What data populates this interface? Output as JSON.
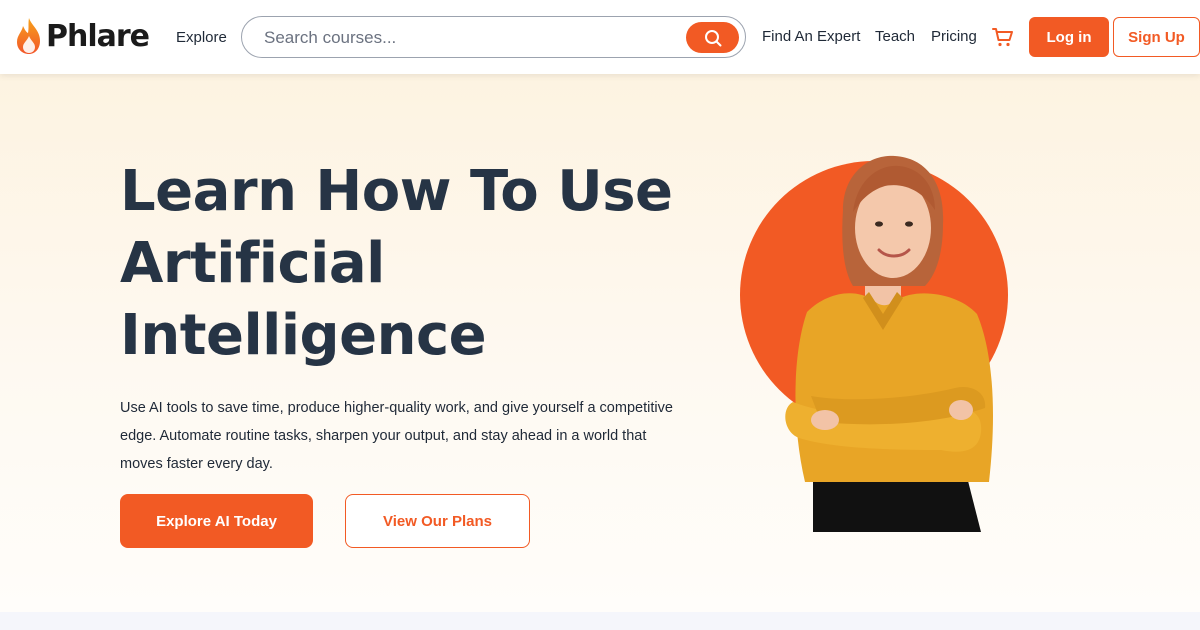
{
  "brand": {
    "name": "Phlare",
    "accent": "#f25a24",
    "heading_color": "#263445"
  },
  "nav": {
    "explore_label": "Explore",
    "search": {
      "placeholder": "Search courses...",
      "value": "",
      "icon": "search-icon"
    },
    "links": [
      "Find An Expert",
      "Teach",
      "Pricing"
    ],
    "cart_icon": "shopping-cart-icon",
    "login_label": "Log in",
    "signup_label": "Sign Up"
  },
  "hero": {
    "headline": "Learn How To Use Artificial Intelligence",
    "description": "Use AI tools to save time, produce higher-quality work, and give yourself a competitive edge. Automate routine tasks, sharpen your output, and stay ahead in a world that moves faster every day.",
    "primary_cta": "Explore AI Today",
    "secondary_cta": "View Our Plans",
    "image": "smiling-woman-arms-crossed-orange-circle"
  }
}
